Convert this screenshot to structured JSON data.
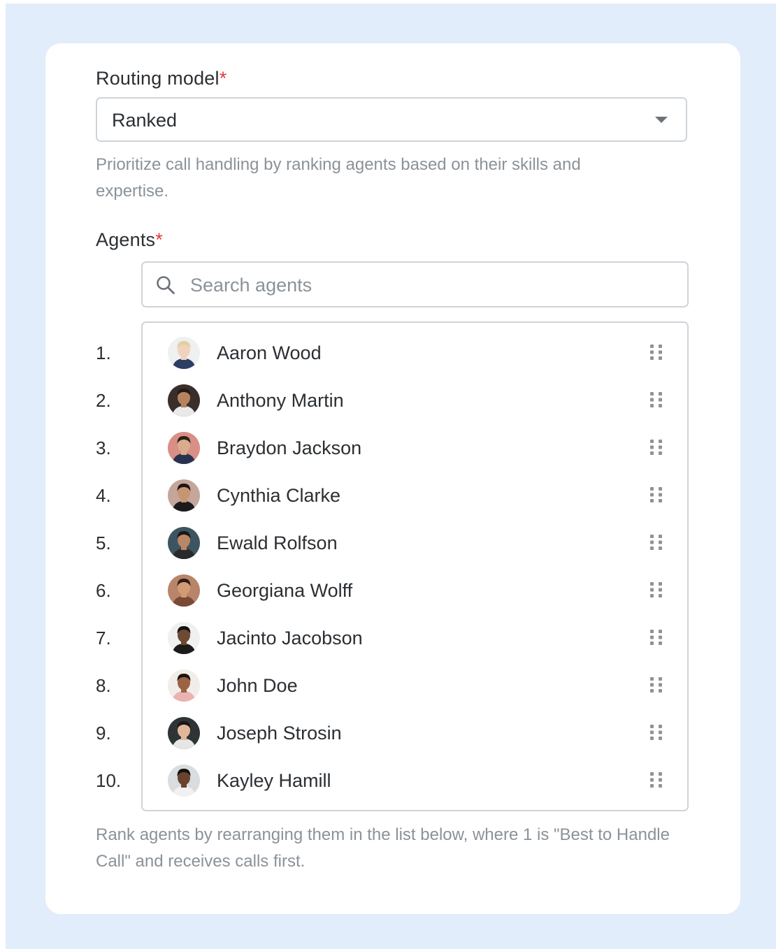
{
  "routing": {
    "label": "Routing model",
    "required_mark": "*",
    "selected": "Ranked",
    "help": "Prioritize call handling by ranking agents based on their skills and expertise."
  },
  "agents": {
    "label": "Agents",
    "required_mark": "*",
    "search_placeholder": "Search agents",
    "help": "Rank agents by rearranging them in the list below, where 1 is \"Best to Handle Call\" and receives calls first.",
    "list": [
      {
        "rank": "1.",
        "name": "Aaron Wood",
        "skin": "#f1d3bd",
        "hair": "#e3cf9f",
        "bg": "#eef0f1",
        "shirt": "#2c3e63"
      },
      {
        "rank": "2.",
        "name": "Anthony Martin",
        "skin": "#b5845f",
        "hair": "#231a16",
        "bg": "#3a2e2a",
        "shirt": "#e9e9ea"
      },
      {
        "rank": "3.",
        "name": "Braydon Jackson",
        "skin": "#d8ac8c",
        "hair": "#2a1f1a",
        "bg": "#d98e86",
        "shirt": "#27324f"
      },
      {
        "rank": "4.",
        "name": "Cynthia Clarke",
        "skin": "#c79572",
        "hair": "#1d1513",
        "bg": "#c4a79a",
        "shirt": "#1b1b1b"
      },
      {
        "rank": "5.",
        "name": "Ewald Rolfson",
        "skin": "#b98666",
        "hair": "#1c1714",
        "bg": "#3d5561",
        "shirt": "#2a2a2a"
      },
      {
        "rank": "6.",
        "name": "Georgiana Wolff",
        "skin": "#d29b74",
        "hair": "#2d1e17",
        "bg": "#b8856b",
        "shirt": "#7a4a34"
      },
      {
        "rank": "7.",
        "name": "Jacinto Jacobson",
        "skin": "#6e4a33",
        "hair": "#141010",
        "bg": "#f0f0f0",
        "shirt": "#1b1b1b"
      },
      {
        "rank": "8.",
        "name": "John Doe",
        "skin": "#9a6444",
        "hair": "#1b1412",
        "bg": "#f2ede9",
        "shirt": "#e8b3b0"
      },
      {
        "rank": "9.",
        "name": "Joseph Strosin",
        "skin": "#e0b899",
        "hair": "#1c1715",
        "bg": "#2e3436",
        "shirt": "#e6e6e6"
      },
      {
        "rank": "10.",
        "name": "Kayley Hamill",
        "skin": "#6a432e",
        "hair": "#16100e",
        "bg": "#d9dde0",
        "shirt": "#f1f1f1"
      }
    ]
  }
}
